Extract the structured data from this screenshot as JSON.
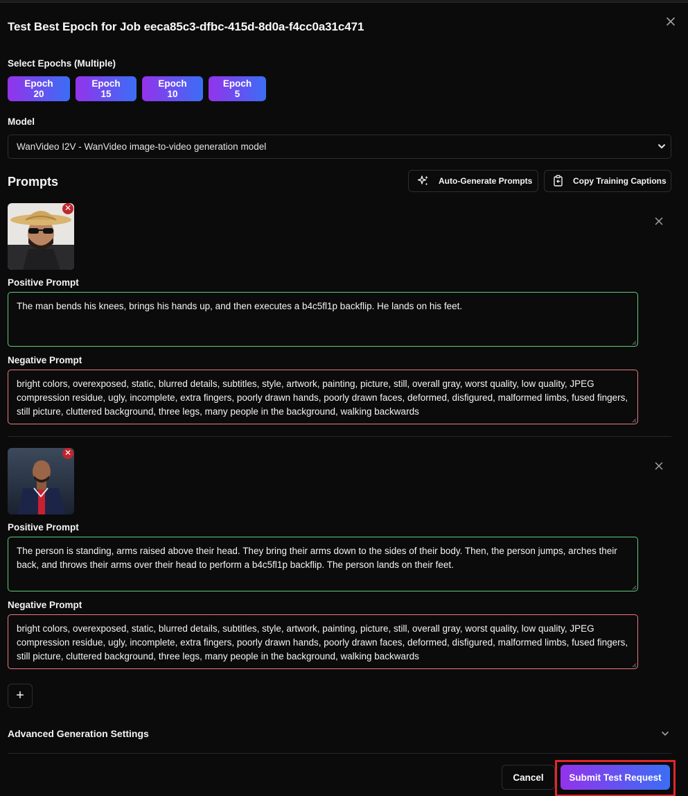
{
  "dialog": {
    "title": "Test Best Epoch for Job eeca85c3-dfbc-415d-8d0a-f4cc0a31c471",
    "close_icon": "close-icon"
  },
  "epochs": {
    "label": "Select Epochs (Multiple)",
    "options": [
      "Epoch 20",
      "Epoch 15",
      "Epoch 10",
      "Epoch 5"
    ]
  },
  "model": {
    "label": "Model",
    "selected": "WanVideo I2V - WanVideo image-to-video generation model"
  },
  "prompts": {
    "title": "Prompts",
    "auto_generate_label": "Auto-Generate Prompts",
    "copy_captions_label": "Copy Training Captions",
    "items": [
      {
        "positive_label": "Positive Prompt",
        "positive": "The man bends his knees, brings his hands up, and then executes a b4c5fl1p backflip. He lands on his feet.",
        "negative_label": "Negative Prompt",
        "negative": "bright colors, overexposed, static, blurred details, subtitles, style, artwork, painting, picture, still, overall gray, worst quality, low quality, JPEG compression residue, ugly, incomplete, extra fingers, poorly drawn hands, poorly drawn faces, deformed, disfigured, malformed limbs, fused fingers, still picture, cluttered background, three legs, many people in the background, walking backwards"
      },
      {
        "positive_label": "Positive Prompt",
        "positive": "The person is standing, arms raised above their head. They bring their arms down to the sides of their body. Then, the person jumps, arches their back, and throws their arms over their head to perform a b4c5fl1p backflip. The person lands on their feet.",
        "negative_label": "Negative Prompt",
        "negative": "bright colors, overexposed, static, blurred details, subtitles, style, artwork, painting, picture, still, overall gray, worst quality, low quality, JPEG compression residue, ugly, incomplete, extra fingers, poorly drawn hands, poorly drawn faces, deformed, disfigured, malformed limbs, fused fingers, still picture, cluttered background, three legs, many people in the background, walking backwards"
      }
    ],
    "add_label": "+"
  },
  "advanced": {
    "label": "Advanced Generation Settings"
  },
  "footer": {
    "cancel_label": "Cancel",
    "submit_label": "Submit Test Request"
  },
  "colors": {
    "accent_start": "#9333ea",
    "accent_end": "#3b6ef5",
    "positive_border": "#5fcf7a",
    "negative_border": "#f07a7a",
    "highlight": "#e3262b"
  }
}
